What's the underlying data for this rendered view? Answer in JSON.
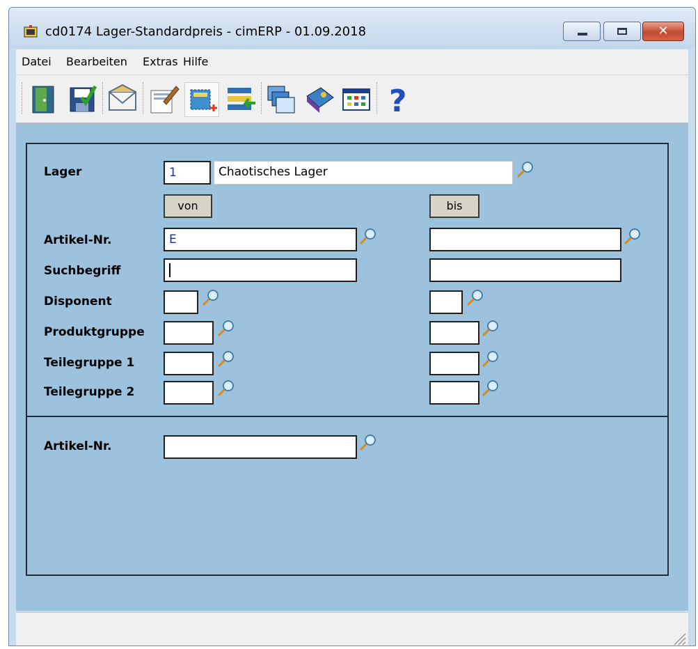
{
  "window": {
    "title": "cd0174 Lager-Standardpreis - cimERP - 01.09.2018",
    "buttons": {
      "minimize": "minimize",
      "maximize": "maximize",
      "close": "✕"
    }
  },
  "menu": [
    "Datei",
    "Bearbeiten",
    "Extras",
    "Hilfe"
  ],
  "toolbar": [
    "exit-icon",
    "save-icon",
    "mail-icon",
    "edit-icon",
    "new-record-icon",
    "list-transfer-icon",
    "windows-icon",
    "book-icon",
    "table-icon",
    "help-icon"
  ],
  "form": {
    "lager": {
      "label": "Lager",
      "number": "1",
      "name": "Chaotisches Lager"
    },
    "von_label": "von",
    "bis_label": "bis",
    "artikel_nr": {
      "label": "Artikel-Nr.",
      "von": "E",
      "bis": ""
    },
    "suchbegriff": {
      "label": "Suchbegriff",
      "von": "",
      "bis": ""
    },
    "disponent": {
      "label": "Disponent",
      "von": "",
      "bis": ""
    },
    "produktgruppe": {
      "label": "Produktgruppe",
      "von": "",
      "bis": ""
    },
    "teilegruppe1": {
      "label": "Teilegruppe 1",
      "von": "",
      "bis": ""
    },
    "teilegruppe2": {
      "label": "Teilegruppe 2",
      "von": "",
      "bis": ""
    },
    "bottom_artikel_nr": {
      "label": "Artikel-Nr.",
      "value": ""
    }
  },
  "colors": {
    "background": "#9dc2de",
    "input_text_blue": "#1a2fa8",
    "title_bar": "#c7dcef"
  }
}
